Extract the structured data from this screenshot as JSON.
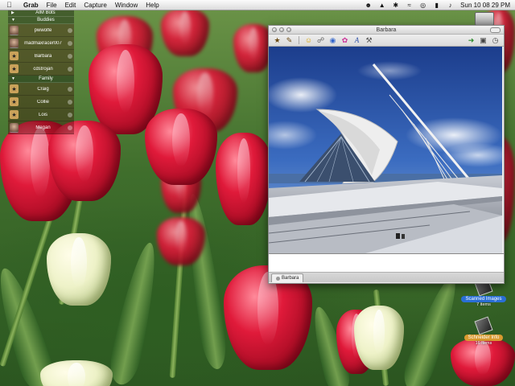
{
  "menubar": {
    "apple_icon": "apple-icon",
    "items": [
      "Grab",
      "File",
      "Edit",
      "Capture",
      "Window",
      "Help"
    ],
    "clock": "Sun 10 08 29 PM",
    "status_icons": [
      "user-icon",
      "volume-icon",
      "bluetooth-icon",
      "wifi-icon",
      "airport-icon",
      "battery-icon",
      "speaker-icon"
    ]
  },
  "buddylist": {
    "groups": [
      {
        "name": "AIM Bots"
      },
      {
        "name": "Buddies"
      },
      {
        "name": "Family"
      }
    ],
    "buddies": {
      "b1": "pwwolfe",
      "b2": "madmaxracer007",
      "b3": "Barbara",
      "b4": "cdstrojan",
      "f1": "Craig",
      "f2": "Collie",
      "f3": "Lois",
      "f4": "Megan"
    }
  },
  "chat": {
    "title": "Barbara",
    "tab_label": "Barbara",
    "toolbar_icons": [
      "buddy-info-icon",
      "warn-icon",
      "smiley-icon",
      "link-icon",
      "globe-icon",
      "color-icon",
      "font-icon",
      "tools-icon",
      "send-file-icon",
      "photo-icon",
      "timer-icon"
    ]
  },
  "desktop": {
    "icons": [
      {
        "label": "Scanned Images",
        "sub": "7 items"
      },
      {
        "label": "Schneider Info",
        "sub": "16 items"
      }
    ]
  },
  "colors": {
    "menubar": "#e8e8e8",
    "tulip_red": "#d8152f",
    "sky_blue": "#2f5fb0",
    "label_blue": "#2a6fd6",
    "label_orange": "#d99a30"
  }
}
